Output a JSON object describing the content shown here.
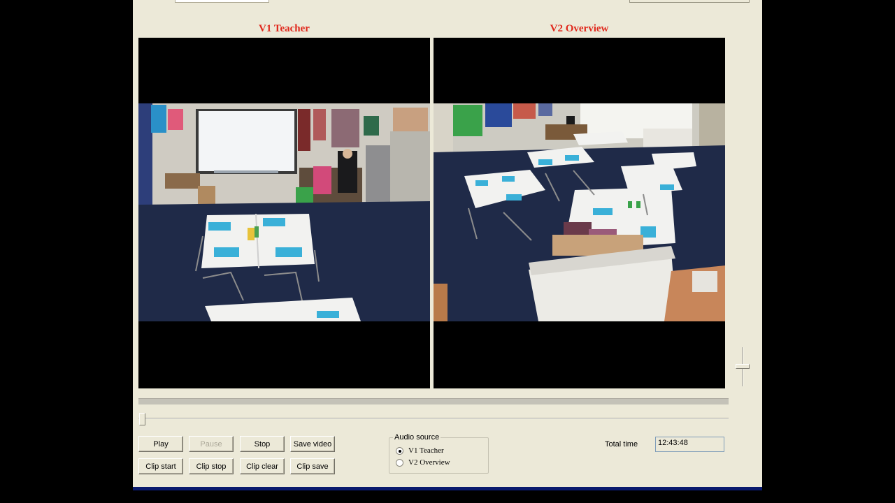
{
  "videos": {
    "v1": {
      "title": "V1 Teacher"
    },
    "v2": {
      "title": "V2 Overview"
    }
  },
  "controls": {
    "play": "Play",
    "pause": "Pause",
    "stop": "Stop",
    "save_video": "Save video",
    "clip_start": "Clip start",
    "clip_stop": "Clip stop",
    "clip_clear": "Clip clear",
    "clip_save": "Clip save"
  },
  "audio_source": {
    "legend": "Audio source",
    "options": [
      "V1 Teacher",
      "V2 Overview"
    ],
    "selected": "V1 Teacher"
  },
  "total_time": {
    "label": "Total time",
    "value": "12:43:48"
  },
  "playback": {
    "position_fraction": 0.0
  },
  "colors": {
    "title_red": "#e0281c",
    "window_bg": "#ece9d8",
    "carpet": "#1f2a48"
  }
}
